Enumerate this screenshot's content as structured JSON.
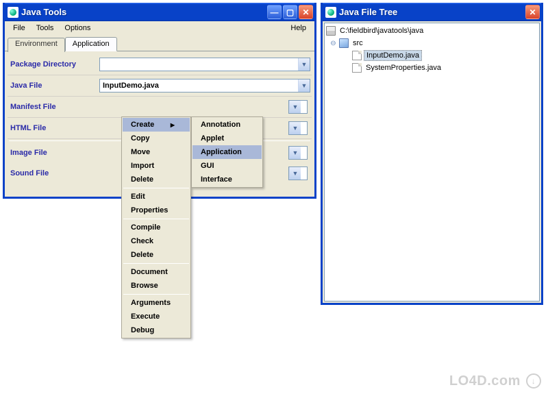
{
  "main": {
    "title": "Java Tools",
    "menu": {
      "file": "File",
      "tools": "Tools",
      "options": "Options",
      "help": "Help"
    },
    "tabs": {
      "env": "Environment",
      "app": "Application"
    },
    "fields": {
      "package_dir": {
        "label": "Package Directory",
        "value": ""
      },
      "java_file": {
        "label": "Java File",
        "value": "InputDemo.java"
      },
      "manifest": {
        "label": "Manifest File",
        "value": ""
      },
      "html_file": {
        "label": "HTML File",
        "value": ""
      },
      "image_file": {
        "label": "Image File",
        "value": ""
      },
      "sound_file": {
        "label": "Sound File",
        "value": ""
      }
    },
    "context": {
      "create": "Create",
      "copy": "Copy",
      "move": "Move",
      "import": "Import",
      "delete": "Delete",
      "edit": "Edit",
      "properties": "Properties",
      "compile": "Compile",
      "check": "Check",
      "delete2": "Delete",
      "document": "Document",
      "browse": "Browse",
      "arguments": "Arguments",
      "execute": "Execute",
      "debug": "Debug"
    },
    "submenu": {
      "annotation": "Annotation",
      "applet": "Applet",
      "application": "Application",
      "gui": "GUI",
      "interface": "Interface"
    }
  },
  "tree": {
    "title": "Java File Tree",
    "root": "C:\\fieldbird\\javatools\\java",
    "folder": "src",
    "file1": "InputDemo.java",
    "file2": "SystemProperties.java"
  },
  "watermark": "LO4D.com"
}
